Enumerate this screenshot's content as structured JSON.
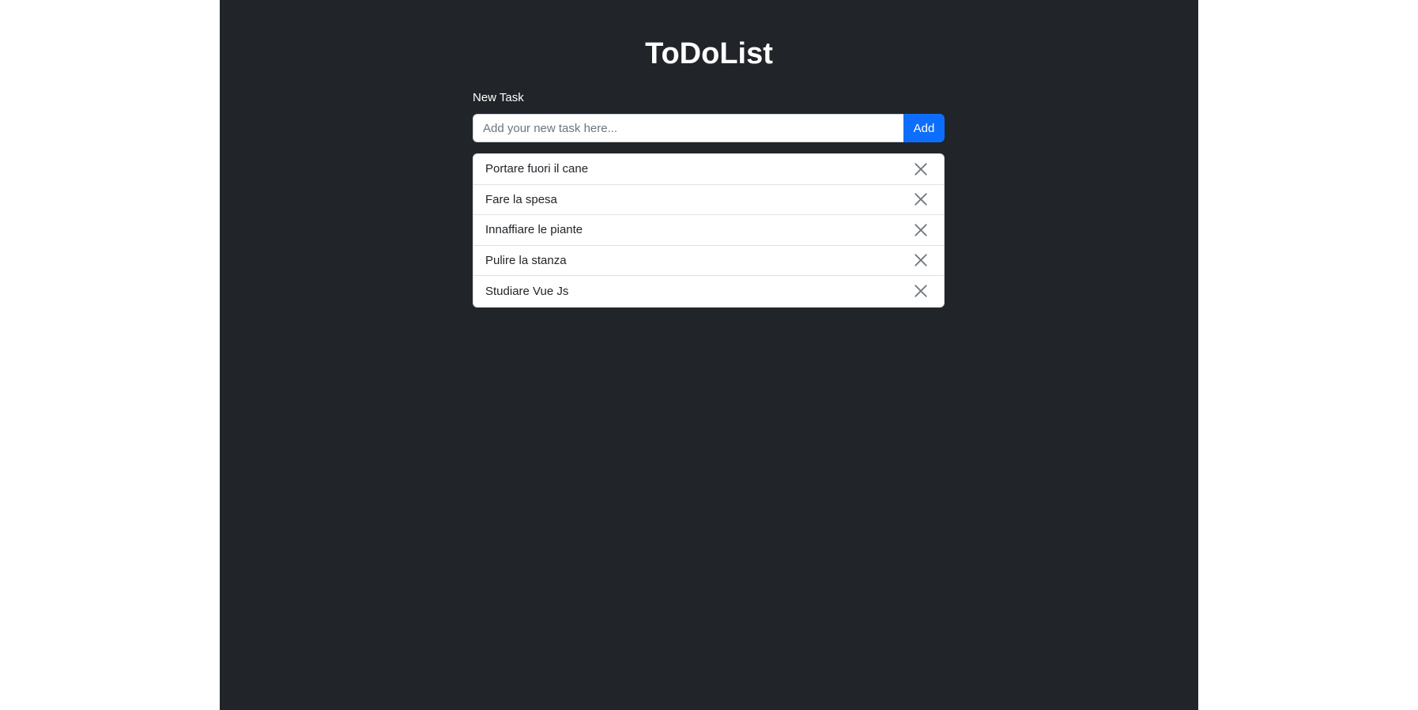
{
  "app": {
    "title": "ToDoList"
  },
  "form": {
    "label": "New Task",
    "input_value": "",
    "input_placeholder": "Add your new task here...",
    "add_label": "Add"
  },
  "tasks": [
    {
      "text": "Portare fuori il cane"
    },
    {
      "text": "Fare la spesa"
    },
    {
      "text": "Innaffiare le piante"
    },
    {
      "text": "Pulire la stanza"
    },
    {
      "text": "Studiare Vue Js"
    }
  ],
  "icons": {
    "delete": "close-icon"
  },
  "colors": {
    "background": "#212529",
    "accent": "#0d6efd",
    "page_side": "#ffffff"
  }
}
